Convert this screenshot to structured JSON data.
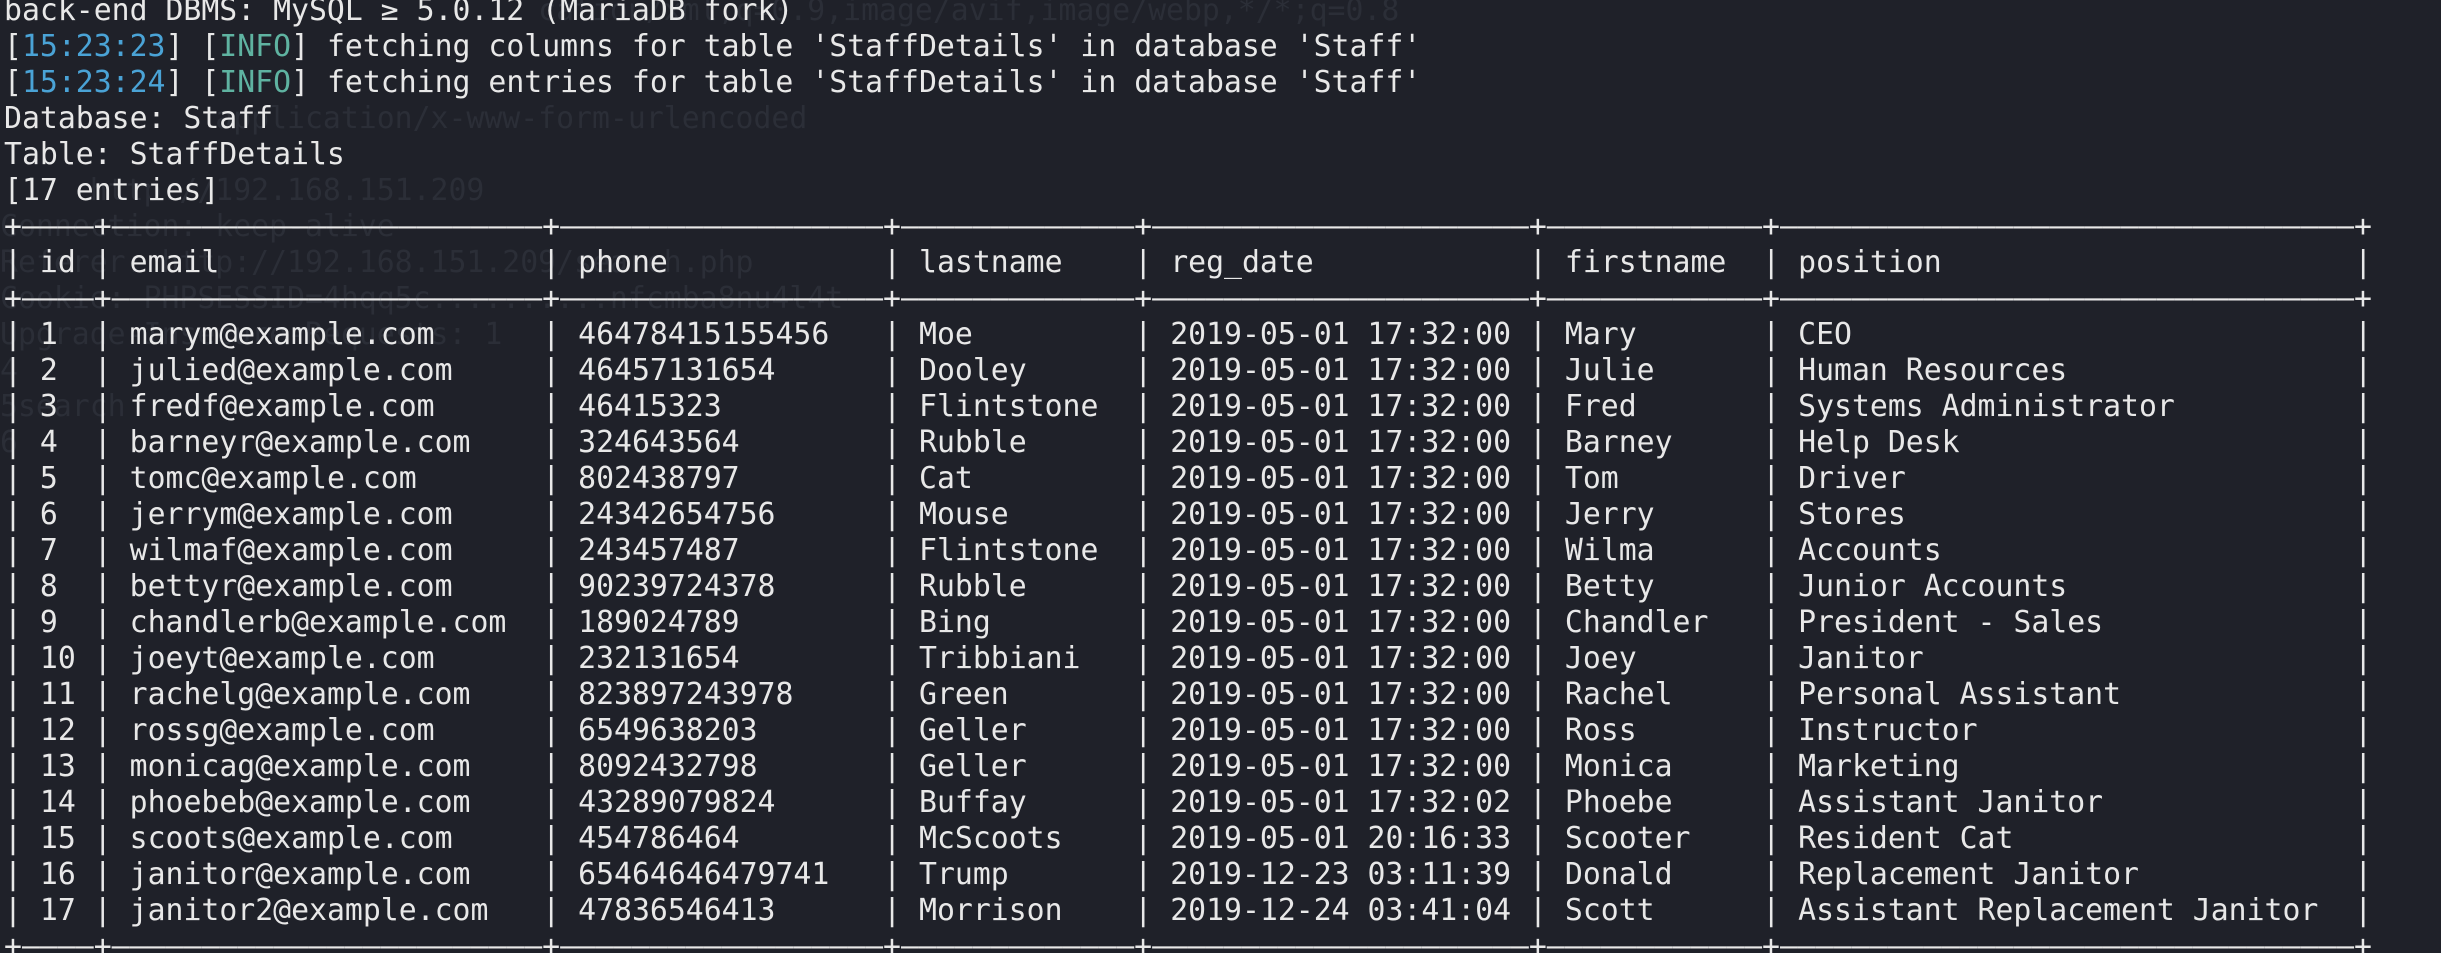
{
  "terminal": {
    "header_lines": [
      "back-end DBMS: MySQL ≥ 5.0.12 (MariaDB fork)"
    ],
    "log_lines": [
      {
        "time": "15:23:23",
        "level": "INFO",
        "message": " fetching columns for table 'StaffDetails' in database 'Staff'"
      },
      {
        "time": "15:23:24",
        "level": "INFO",
        "message": " fetching entries for table 'StaffDetails' in database 'Staff'"
      }
    ],
    "database_line": "Database: Staff",
    "table_line": "Table: StaffDetails",
    "entries_line": "[17 entries]",
    "ghost_lines": [
      "                              cation/xml;q=0.9,image/avif,image/webp,*/*;q=0.8",
      "",
      "",
      "            application/x-www-form-urlencoded",
      "",
      "     http://192.168.151.209",
      "Connection: keep-alive",
      "Referer: http://192.168.151.209/search.php",
      "Cookie: PHPSESSID=4hqq5c..........nfcmba8nu4l4t",
      "Upgrade-Insecure-Requests: 1",
      "4",
      "5search",
      "6"
    ]
  },
  "table": {
    "columns": [
      "id",
      "email",
      "phone",
      "lastname",
      "reg_date",
      "firstname",
      "position"
    ],
    "widths": [
      2,
      22,
      16,
      11,
      19,
      10,
      30
    ],
    "rows": [
      [
        "1",
        "marym@example.com",
        "46478415155456",
        "Moe",
        "2019-05-01 17:32:00",
        "Mary",
        "CEO"
      ],
      [
        "2",
        "julied@example.com",
        "46457131654",
        "Dooley",
        "2019-05-01 17:32:00",
        "Julie",
        "Human Resources"
      ],
      [
        "3",
        "fredf@example.com",
        "46415323",
        "Flintstone",
        "2019-05-01 17:32:00",
        "Fred",
        "Systems Administrator"
      ],
      [
        "4",
        "barneyr@example.com",
        "324643564",
        "Rubble",
        "2019-05-01 17:32:00",
        "Barney",
        "Help Desk"
      ],
      [
        "5",
        "tomc@example.com",
        "802438797",
        "Cat",
        "2019-05-01 17:32:00",
        "Tom",
        "Driver"
      ],
      [
        "6",
        "jerrym@example.com",
        "24342654756",
        "Mouse",
        "2019-05-01 17:32:00",
        "Jerry",
        "Stores"
      ],
      [
        "7",
        "wilmaf@example.com",
        "243457487",
        "Flintstone",
        "2019-05-01 17:32:00",
        "Wilma",
        "Accounts"
      ],
      [
        "8",
        "bettyr@example.com",
        "90239724378",
        "Rubble",
        "2019-05-01 17:32:00",
        "Betty",
        "Junior Accounts"
      ],
      [
        "9",
        "chandlerb@example.com",
        "189024789",
        "Bing",
        "2019-05-01 17:32:00",
        "Chandler",
        "President - Sales"
      ],
      [
        "10",
        "joeyt@example.com",
        "232131654",
        "Tribbiani",
        "2019-05-01 17:32:00",
        "Joey",
        "Janitor"
      ],
      [
        "11",
        "rachelg@example.com",
        "823897243978",
        "Green",
        "2019-05-01 17:32:00",
        "Rachel",
        "Personal Assistant"
      ],
      [
        "12",
        "rossg@example.com",
        "6549638203",
        "Geller",
        "2019-05-01 17:32:00",
        "Ross",
        "Instructor"
      ],
      [
        "13",
        "monicag@example.com",
        "8092432798",
        "Geller",
        "2019-05-01 17:32:00",
        "Monica",
        "Marketing"
      ],
      [
        "14",
        "phoebeb@example.com",
        "43289079824",
        "Buffay",
        "2019-05-01 17:32:02",
        "Phoebe",
        "Assistant Janitor"
      ],
      [
        "15",
        "scoots@example.com",
        "454786464",
        "McScoots",
        "2019-05-01 20:16:33",
        "Scooter",
        "Resident Cat"
      ],
      [
        "16",
        "janitor@example.com",
        "65464646479741",
        "Trump",
        "2019-12-23 03:11:39",
        "Donald",
        "Replacement Janitor"
      ],
      [
        "17",
        "janitor2@example.com",
        "47836546413",
        "Morrison",
        "2019-12-24 03:41:04",
        "Scott",
        "Assistant Replacement Janitor"
      ]
    ]
  },
  "colors": {
    "background": "#1f2129",
    "text": "#e8e8e8",
    "timestamp": "#4aa3d6",
    "info": "#5fb3a1",
    "ghost": "#2b2e37"
  }
}
